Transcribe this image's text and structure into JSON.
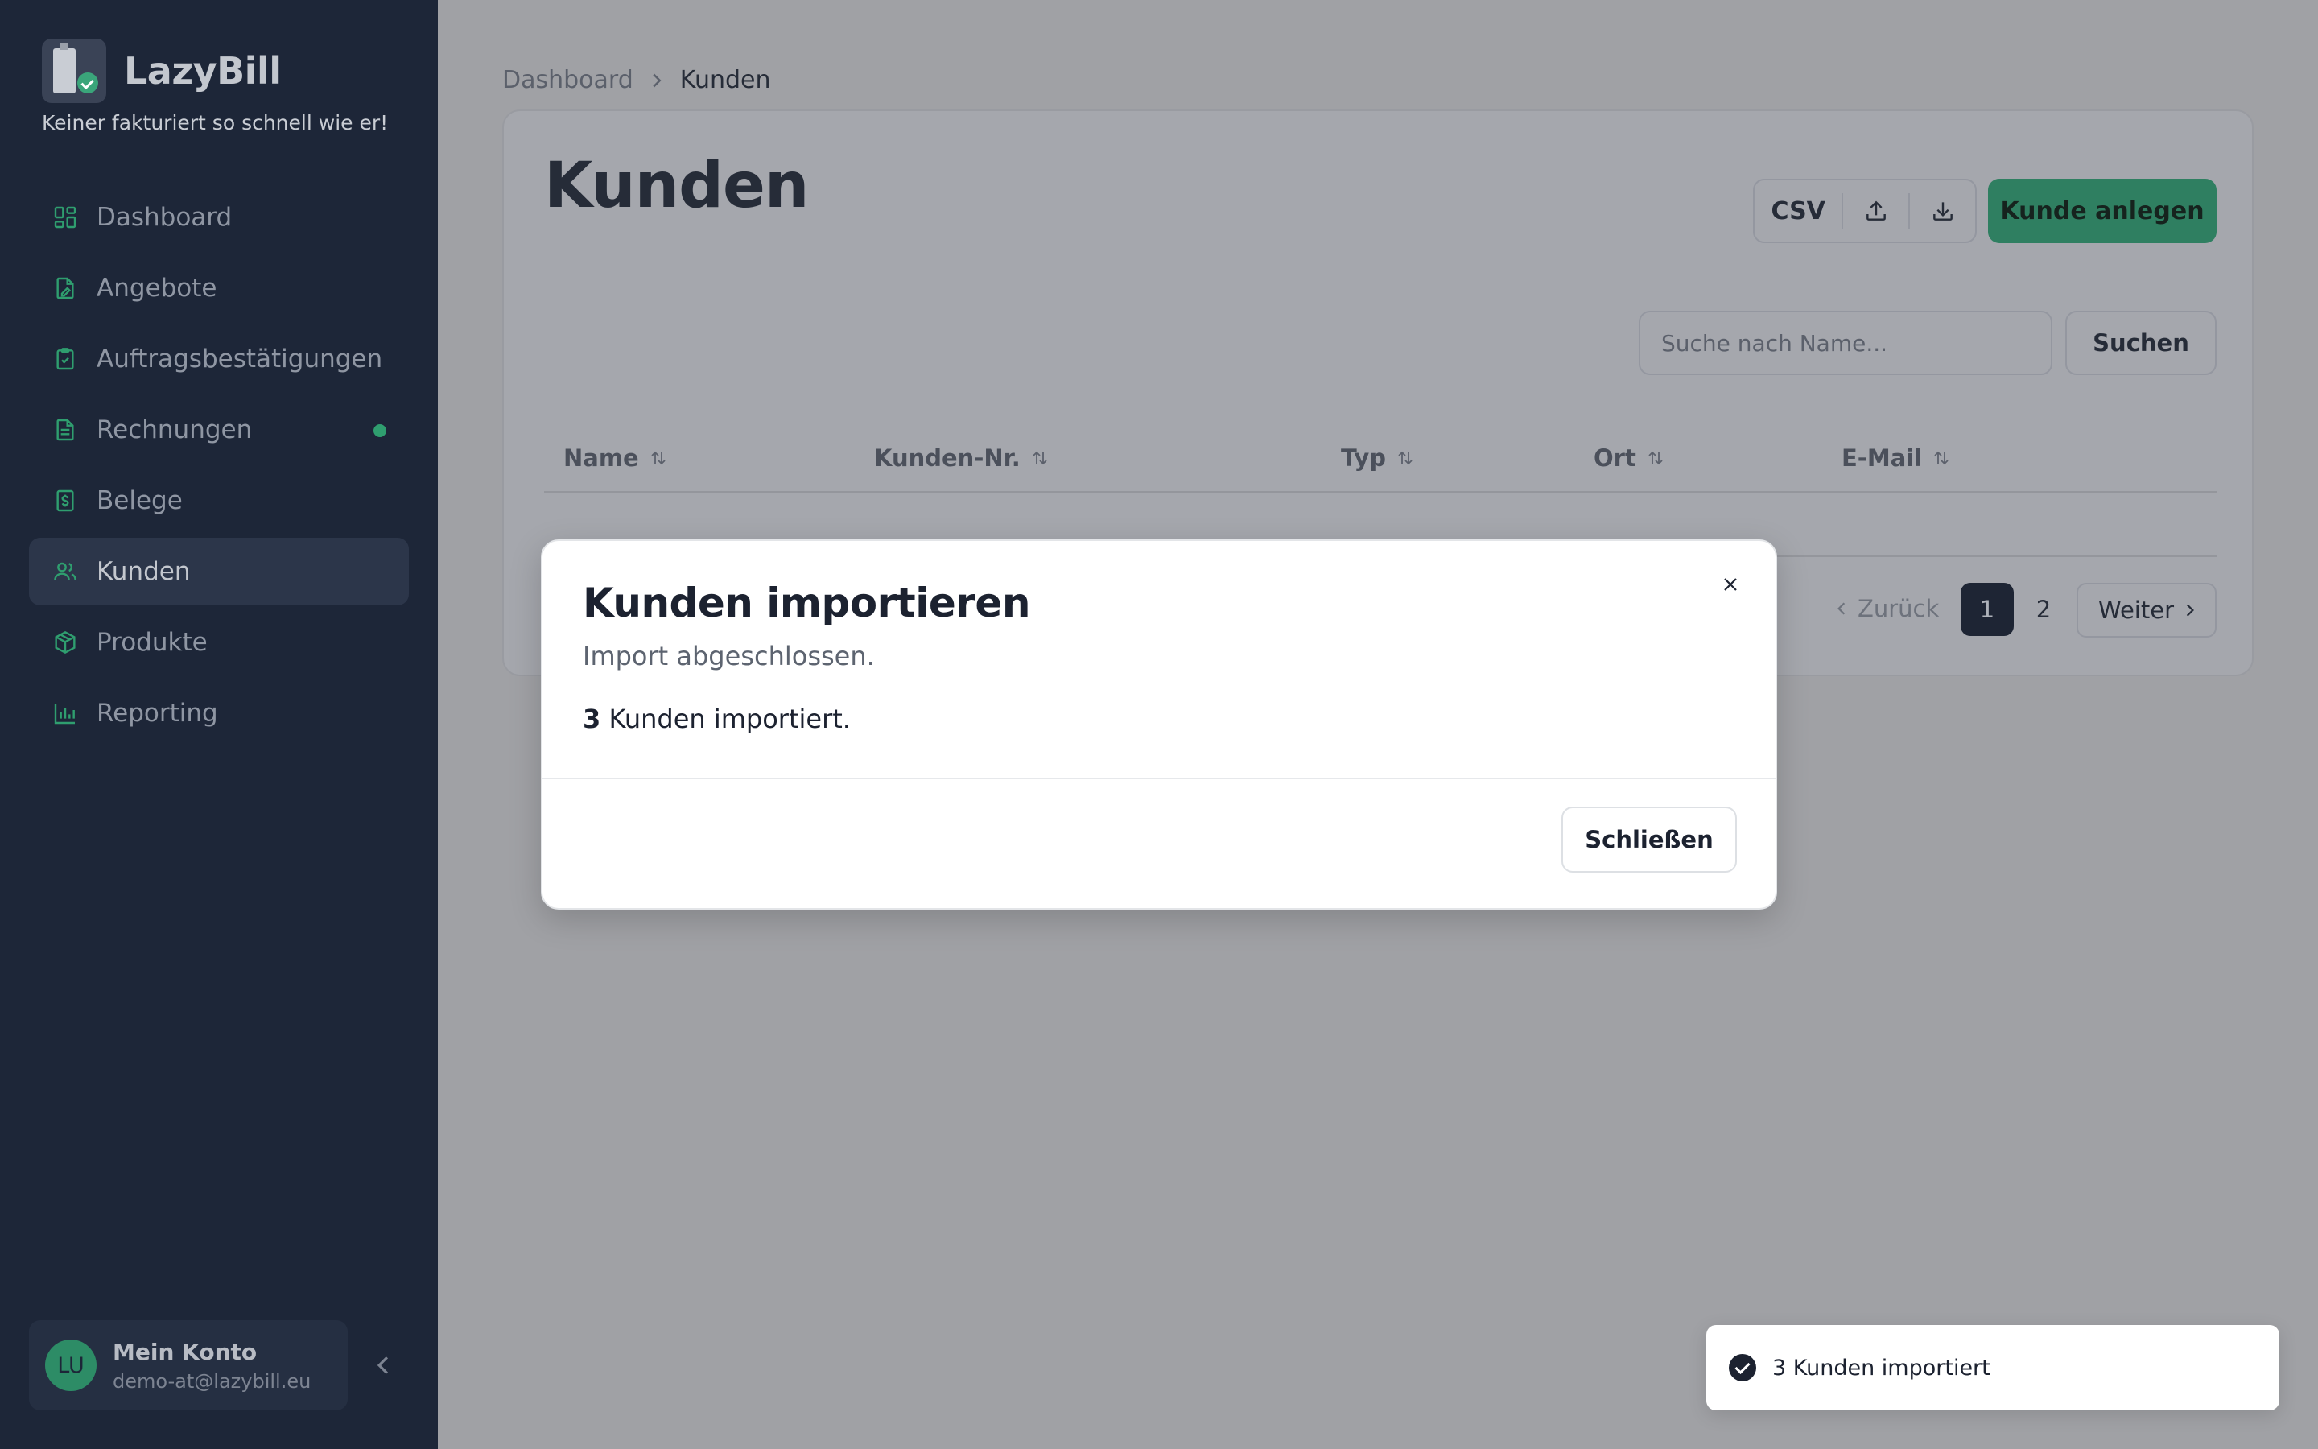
{
  "app": {
    "name": "LazyBill",
    "tagline": "Keiner fakturiert so schnell wie er!"
  },
  "sidebar": {
    "items": [
      {
        "label": "Dashboard",
        "icon": "dashboard-icon"
      },
      {
        "label": "Angebote",
        "icon": "quote-document-icon"
      },
      {
        "label": "Auftragsbestätigungen",
        "icon": "clipboard-check-icon"
      },
      {
        "label": "Rechnungen",
        "icon": "invoice-icon",
        "badge_dot": true
      },
      {
        "label": "Belege",
        "icon": "receipt-icon"
      },
      {
        "label": "Kunden",
        "icon": "users-icon",
        "active": true
      },
      {
        "label": "Produkte",
        "icon": "box-icon"
      },
      {
        "label": "Reporting",
        "icon": "bar-chart-icon"
      }
    ],
    "account": {
      "initials": "LU",
      "name": "Mein Konto",
      "email": "demo-at@lazybill.eu"
    }
  },
  "breadcrumb": {
    "parent": "Dashboard",
    "current": "Kunden"
  },
  "main": {
    "title": "Kunden",
    "csv_label": "CSV",
    "create_button": "Kunde anlegen",
    "search_placeholder": "Suche nach Name...",
    "search_button": "Suchen",
    "columns": [
      "Name",
      "Kunden-Nr.",
      "Typ",
      "Ort",
      "E-Mail"
    ],
    "pagination": {
      "prev": "Zurück",
      "pages": [
        "1",
        "2"
      ],
      "current": "1",
      "next": "Weiter"
    }
  },
  "modal": {
    "title": "Kunden importieren",
    "subtitle": "Import abgeschlossen.",
    "count": "3",
    "message": "Kunden importiert.",
    "close_button": "Schließen"
  },
  "toast": {
    "text": "3 Kunden importiert"
  },
  "colors": {
    "sidebar_bg": "#1d2638",
    "accent_green": "#3aa57a",
    "overlay_bg": "#a0a1a5"
  }
}
